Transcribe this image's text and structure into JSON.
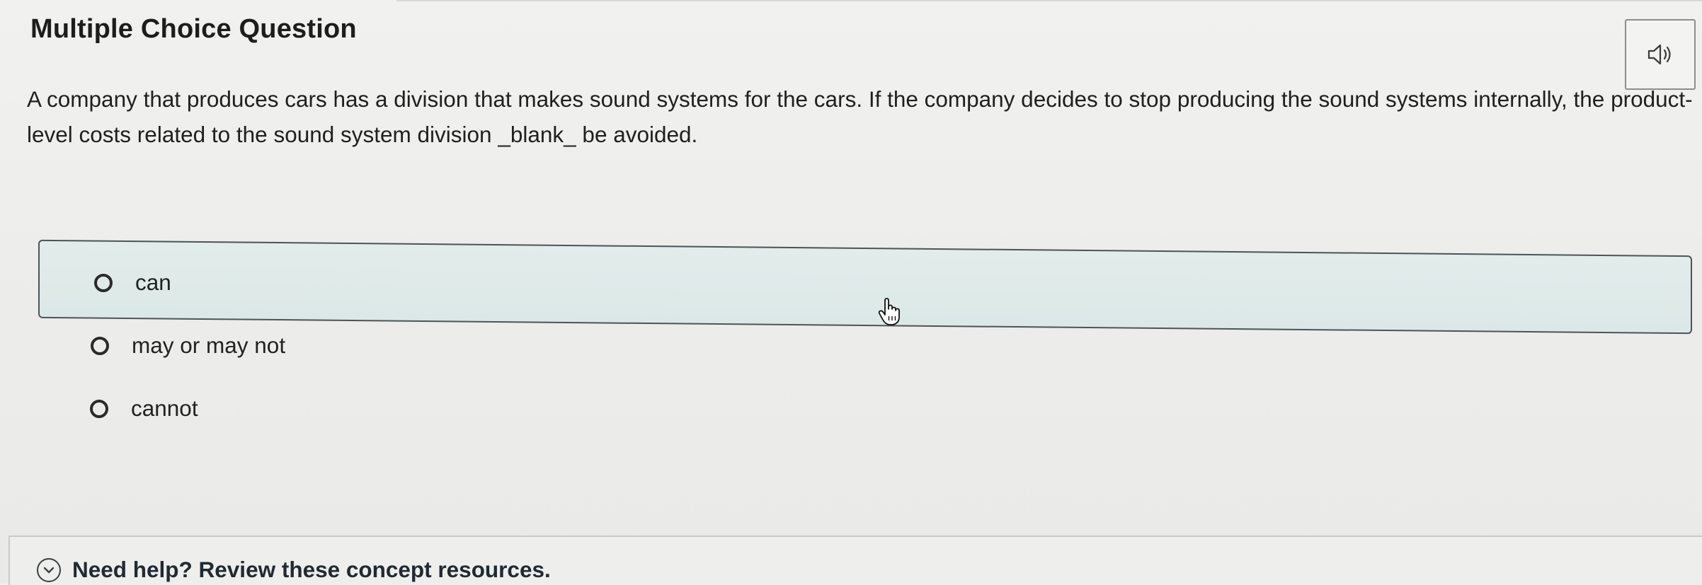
{
  "header": {
    "title": "Multiple Choice Question"
  },
  "audio": {
    "icon": "speaker-icon"
  },
  "question": {
    "text": "A company that produces cars has a division that makes sound systems for the cars.  If the company decides to stop producing the sound systems internally, the product-level costs related to the sound system division _blank_ be avoided."
  },
  "options": [
    {
      "label": "can",
      "highlighted": true
    },
    {
      "label": "may or may not",
      "highlighted": false
    },
    {
      "label": "cannot",
      "highlighted": false
    }
  ],
  "help": {
    "icon": "chevron-down-circle-icon",
    "text": "Need help? Review these concept resources."
  },
  "colors": {
    "highlight_bg": "#dce8e7",
    "highlight_border": "#4c5457",
    "text": "#1f1f1f"
  }
}
